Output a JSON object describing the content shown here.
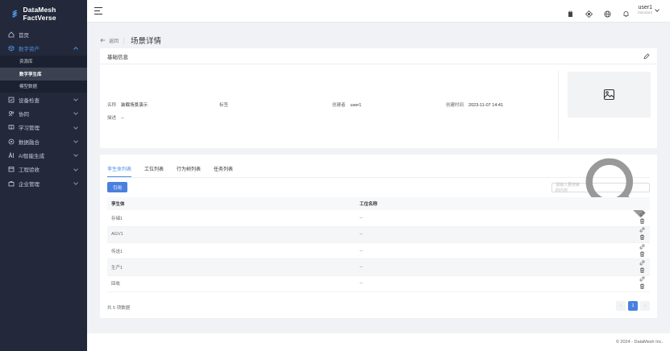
{
  "app": {
    "name": "DataMesh FactVerse",
    "brand_color": "#4a90e2"
  },
  "sidebar": {
    "items": [
      {
        "label": "首页",
        "icon": "home-icon"
      },
      {
        "label": "数字资产",
        "icon": "cube-icon"
      },
      {
        "label": "设备检查",
        "icon": "checklist-icon"
      },
      {
        "label": "协同",
        "icon": "users-icon"
      },
      {
        "label": "学习管理",
        "icon": "book-icon"
      },
      {
        "label": "数据融合",
        "icon": "database-icon"
      },
      {
        "label": "AI智能生成",
        "icon": "ai-icon"
      },
      {
        "label": "工程验收",
        "icon": "calendar-icon"
      },
      {
        "label": "企业管理",
        "icon": "briefcase-icon"
      }
    ],
    "subitems": [
      "资源库",
      "数字孪生库",
      "模型数据"
    ]
  },
  "header": {
    "user_name": "user1",
    "user_role": "Standard"
  },
  "breadcrumb": {
    "back": "返回",
    "title": "场景详情"
  },
  "info": {
    "heading": "基础信息",
    "name_label": "名称",
    "name_value": "装载场景演示",
    "tag_label": "标签",
    "creator_label": "创建者",
    "creator_value": "user1",
    "created_label": "创建时间",
    "created_value": "2023-11-07 14:41",
    "desc_label": "描述",
    "desc_value": "--"
  },
  "tabs": [
    "孪生体列表",
    "工位列表",
    "行为树列表",
    "任务列表"
  ],
  "list": {
    "cite_button": "引用",
    "search_placeholder": "请输入要搜索的内容",
    "columns": [
      "孪生体",
      "工位名称"
    ],
    "rows": [
      {
        "name": "存储1",
        "station": "--"
      },
      {
        "name": "AGV1",
        "station": "--"
      },
      {
        "name": "传送1",
        "station": "--"
      },
      {
        "name": "生产1",
        "station": "--"
      },
      {
        "name": "回收",
        "station": "--"
      }
    ],
    "total": "共 5 项数据",
    "page": "1"
  },
  "footer": "© 2024 - DataMesh Inc."
}
